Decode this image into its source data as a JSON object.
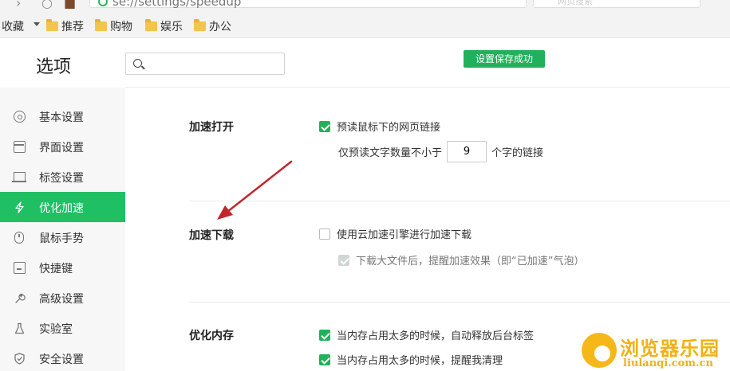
{
  "browser": {
    "address_text": "se://settings/speedup",
    "search_placeholder": "网页搜索"
  },
  "bookmarks": {
    "favorites_label": "收藏",
    "items": [
      {
        "label": "推荐"
      },
      {
        "label": "购物"
      },
      {
        "label": "娱乐"
      },
      {
        "label": "办公"
      }
    ]
  },
  "header": {
    "title": "选项",
    "search_placeholder": "",
    "save_status": "设置保存成功"
  },
  "sidebar": {
    "items": [
      {
        "label": "基本设置",
        "icon": "gear-icon",
        "active": false
      },
      {
        "label": "界面设置",
        "icon": "window-icon",
        "active": false
      },
      {
        "label": "标签设置",
        "icon": "tab-icon",
        "active": false
      },
      {
        "label": "优化加速",
        "icon": "lightning-icon",
        "active": true
      },
      {
        "label": "鼠标手势",
        "icon": "mouse-icon",
        "active": false
      },
      {
        "label": "快捷键",
        "icon": "keyboard-icon",
        "active": false
      },
      {
        "label": "高级设置",
        "icon": "wrench-icon",
        "active": false
      },
      {
        "label": "实验室",
        "icon": "flask-icon",
        "active": false
      },
      {
        "label": "安全设置",
        "icon": "shield-icon",
        "active": false
      }
    ]
  },
  "sections": {
    "speed_open": {
      "label": "加速打开",
      "preload_label": "预读鼠标下的网页链接",
      "preload_checked": true,
      "min_chars_prefix": "仅预读文字数量不小于",
      "min_chars_value": "9",
      "min_chars_suffix": "个字的链接"
    },
    "speed_download": {
      "label": "加速下载",
      "cloud_label": "使用云加速引擎进行加速下载",
      "cloud_checked": false,
      "notify_label": "下载大文件后，提醒加速效果（即“已加速”气泡）",
      "notify_checked": true,
      "notify_disabled": true
    },
    "optimize_memory": {
      "label": "优化内存",
      "auto_release_label": "当内存占用太多的时候，自动释放后台标签",
      "auto_release_checked": true,
      "remind_label": "当内存占用太多的时候，提醒我清理",
      "remind_checked": true
    }
  },
  "watermark": {
    "name": "浏览器乐园",
    "url": "liulanqi.com.cn"
  },
  "colors": {
    "accent": "#1fc063",
    "save_badge": "#21b15b",
    "annotation_arrow": "#c0272d",
    "watermark": "#f0b214"
  }
}
